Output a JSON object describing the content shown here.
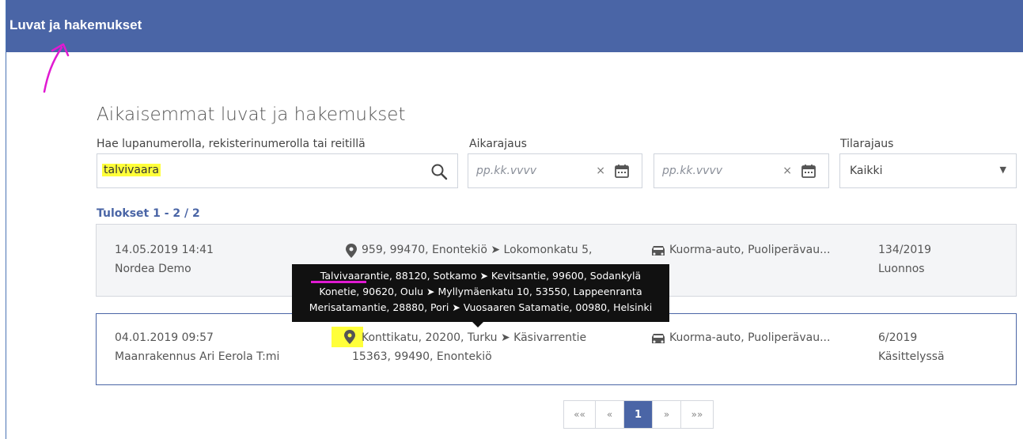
{
  "header": {
    "title": "Luvat ja hakemukset"
  },
  "main": {
    "section_title": "Aikaisemmat luvat ja hakemukset",
    "search": {
      "label": "Hae lupanumerolla, rekisterinumerolla tai reitillä",
      "value": "talvivaara",
      "icon": "search-icon"
    },
    "time_filter": {
      "label": "Aikarajaus",
      "from_placeholder": "pp.kk.vvvv",
      "to_placeholder": "pp.kk.vvvv",
      "clear": "×",
      "icon": "calendar-icon"
    },
    "state_filter": {
      "label": "Tilarajaus",
      "selected": "Kaikki",
      "caret": "▼"
    },
    "results_count": "Tulokset 1 - 2 / 2"
  },
  "results": [
    {
      "date": "14.05.2019 14:41",
      "company": "Nordea Demo",
      "route_line1": "959, 99470, Enontekiö ➤ Lokomonkatu 5,",
      "vehicle": "Kuorma-auto, Puoliperävau...",
      "number": "134/2019",
      "status": "Luonnos"
    },
    {
      "date": "04.01.2019 09:57",
      "company": "Maanrakennus Ari Eerola T:mi",
      "route_line1": "Konttikatu, 20200, Turku ➤ Käsivarrentie",
      "route_line2": "15363, 99490, Enontekiö",
      "vehicle": "Kuorma-auto, Puoliperävau...",
      "number": "6/2019",
      "status": "Käsittelyssä"
    }
  ],
  "tooltip": {
    "line1": "Talvivaarantie, 88120, Sotkamo ➤ Kevitsantie, 99600, Sodankylä",
    "line2": "Konetie, 90620, Oulu ➤ Myllymäenkatu 10, 53550, Lappeenranta",
    "line3": "Merisatamantie, 28880, Pori ➤ Vuosaaren Satamatie, 00980, Helsinki"
  },
  "pagination": {
    "first": "««",
    "prev": "«",
    "current": "1",
    "next": "»",
    "last": "»»"
  },
  "colors": {
    "header": "#4a65a6",
    "highlight": "#ffff3a",
    "annotation": "#e01ad1"
  }
}
